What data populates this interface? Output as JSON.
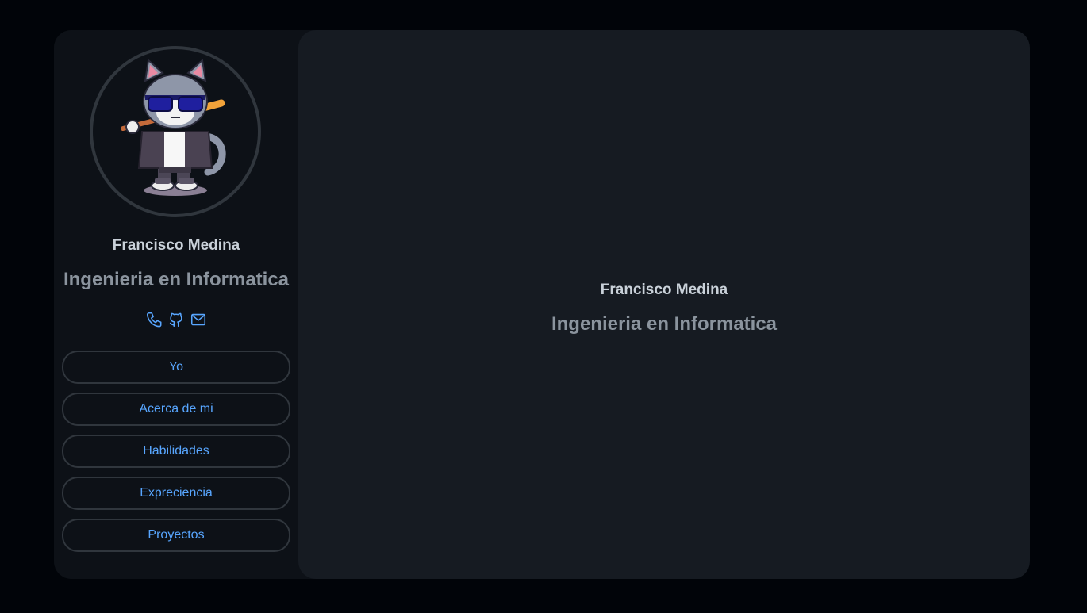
{
  "profile": {
    "name": "Francisco Medina",
    "title": "Ingenieria en Informatica",
    "avatar_icon": "cat-with-sunglasses-avatar"
  },
  "contacts": [
    {
      "icon": "phone-icon"
    },
    {
      "icon": "github-icon"
    },
    {
      "icon": "mail-icon"
    }
  ],
  "nav": {
    "items": [
      {
        "label": "Yo"
      },
      {
        "label": "Acerca de mi"
      },
      {
        "label": "Habilidades"
      },
      {
        "label": "Expreciencia"
      },
      {
        "label": "Proyectos"
      }
    ]
  },
  "main": {
    "name": "Francisco Medina",
    "title": "Ingenieria en Informatica"
  },
  "colors": {
    "page_bg": "#010409",
    "sidebar_bg": "#0d1117",
    "main_bg": "#161b22",
    "accent": "#58a6ff",
    "text_primary": "#c9d1d9",
    "text_secondary": "#8b949e",
    "border": "#30363d"
  }
}
